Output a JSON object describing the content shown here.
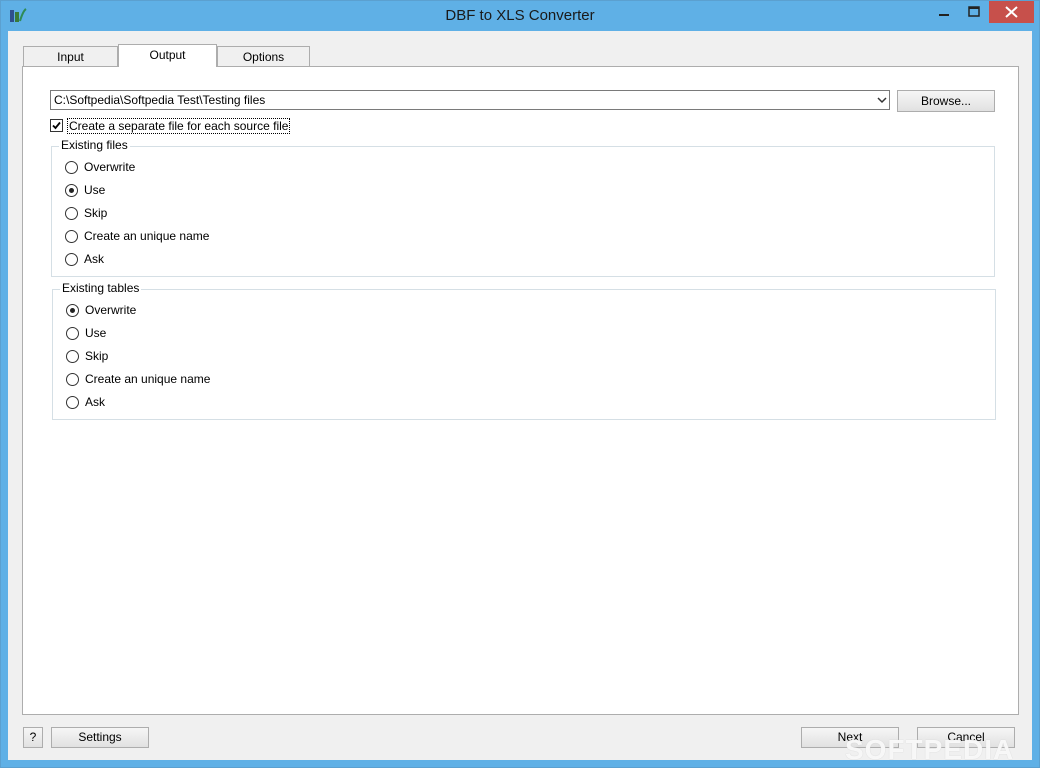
{
  "window": {
    "title": "DBF to XLS Converter"
  },
  "tabs": [
    {
      "label": "Input"
    },
    {
      "label": "Output"
    },
    {
      "label": "Options"
    }
  ],
  "output": {
    "path_value": "C:\\Softpedia\\Softpedia Test\\Testing files",
    "browse_label": "Browse...",
    "separate_file_label": "Create a separate file for each source file",
    "separate_file_checked": true
  },
  "existing_files": {
    "legend": "Existing files",
    "options": [
      {
        "label": "Overwrite"
      },
      {
        "label": "Use"
      },
      {
        "label": "Skip"
      },
      {
        "label": "Create an unique name"
      },
      {
        "label": "Ask"
      }
    ],
    "selected": "Use"
  },
  "existing_tables": {
    "legend": "Existing tables",
    "options": [
      {
        "label": "Overwrite"
      },
      {
        "label": "Use"
      },
      {
        "label": "Skip"
      },
      {
        "label": "Create an unique name"
      },
      {
        "label": "Ask"
      }
    ],
    "selected": "Overwrite"
  },
  "footer": {
    "help_label": "?",
    "settings_label": "Settings",
    "next_label": "Next",
    "cancel_label": "Cancel"
  },
  "watermark": "SOFTPEDIA",
  "colors": {
    "titlebar": "#5fb0e6",
    "close_button": "#c7504b"
  }
}
